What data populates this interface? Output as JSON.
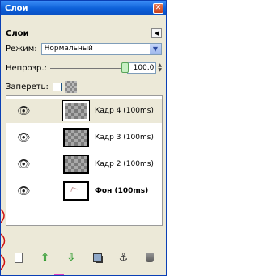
{
  "window": {
    "title": "Слои"
  },
  "panel": {
    "title": "Слои"
  },
  "mode": {
    "label": "Режим:",
    "value": "Нормальный"
  },
  "opacity": {
    "label": "Непрозр.:",
    "value": "100,0",
    "level": 1.0
  },
  "lock": {
    "label": "Запереть:"
  },
  "layers": [
    {
      "name": "Кадр 4 (100ms)",
      "selected": true,
      "visible": true
    },
    {
      "name": "Кадр 3 (100ms)",
      "selected": false,
      "visible": true
    },
    {
      "name": "Кадр 2 (100ms)",
      "selected": false,
      "visible": true
    },
    {
      "name": "Фон (100ms)",
      "selected": false,
      "visible": true
    }
  ],
  "toolbar": {
    "buttons": [
      "new-layer-icon",
      "raise-layer-icon",
      "lower-layer-icon",
      "duplicate-layer-icon",
      "anchor-layer-icon",
      "delete-layer-icon"
    ]
  },
  "colors": {
    "titlebar": "#0c5fd8",
    "window_bg": "#ece9d8",
    "accent_red": "#d01010",
    "accent_pink": "#e040c0"
  }
}
